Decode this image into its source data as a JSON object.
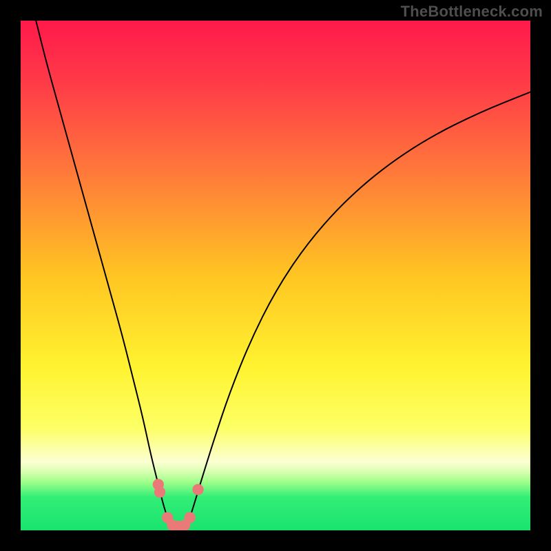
{
  "watermark": "TheBottleneck.com",
  "chart_data": {
    "type": "line",
    "title": "",
    "xlabel": "",
    "ylabel": "",
    "xlim": [
      0,
      100
    ],
    "ylim": [
      0,
      100
    ],
    "gradient_stops": [
      {
        "offset": 0.0,
        "color": "#ff1a4b"
      },
      {
        "offset": 0.12,
        "color": "#ff3a48"
      },
      {
        "offset": 0.3,
        "color": "#ff7a3a"
      },
      {
        "offset": 0.5,
        "color": "#ffc522"
      },
      {
        "offset": 0.68,
        "color": "#fff330"
      },
      {
        "offset": 0.8,
        "color": "#fdff66"
      },
      {
        "offset": 0.865,
        "color": "#fcffd2"
      },
      {
        "offset": 0.885,
        "color": "#d8ffb0"
      },
      {
        "offset": 0.905,
        "color": "#9fff8a"
      },
      {
        "offset": 0.935,
        "color": "#33ee77"
      },
      {
        "offset": 1.0,
        "color": "#19e36e"
      }
    ],
    "series": [
      {
        "name": "left-curve",
        "stroke": "#000000",
        "x": [
          3.0,
          5.0,
          7.5,
          10.0,
          12.5,
          15.0,
          17.5,
          20.0,
          22.0,
          24.0,
          25.5,
          27.0,
          28.0,
          28.8
        ],
        "y": [
          100.0,
          92.0,
          83.0,
          74.0,
          65.0,
          56.0,
          47.0,
          38.0,
          30.0,
          22.0,
          15.0,
          9.0,
          5.0,
          2.5
        ]
      },
      {
        "name": "right-curve",
        "stroke": "#000000",
        "x": [
          33.2,
          34.0,
          35.5,
          38.0,
          41.0,
          45.0,
          50.0,
          56.0,
          63.0,
          71.0,
          80.0,
          90.0,
          100.0
        ],
        "y": [
          2.5,
          5.0,
          10.0,
          18.0,
          27.0,
          37.0,
          47.0,
          56.0,
          64.0,
          71.0,
          77.0,
          82.0,
          86.0
        ]
      },
      {
        "name": "bottom-link",
        "stroke": "#e97a78",
        "x": [
          28.8,
          29.8,
          31.0,
          32.2,
          33.2
        ],
        "y": [
          2.5,
          1.0,
          0.8,
          1.0,
          2.5
        ]
      }
    ],
    "markers": [
      {
        "x": 27.0,
        "y": 9.0,
        "r": 1.1,
        "color": "#e97a78"
      },
      {
        "x": 27.3,
        "y": 7.5,
        "r": 1.1,
        "color": "#e97a78"
      },
      {
        "x": 28.8,
        "y": 2.5,
        "r": 1.1,
        "color": "#e97a78"
      },
      {
        "x": 29.8,
        "y": 1.0,
        "r": 1.1,
        "color": "#e97a78"
      },
      {
        "x": 31.0,
        "y": 0.8,
        "r": 1.1,
        "color": "#e97a78"
      },
      {
        "x": 32.2,
        "y": 1.0,
        "r": 1.1,
        "color": "#e97a78"
      },
      {
        "x": 33.2,
        "y": 2.5,
        "r": 1.1,
        "color": "#e97a78"
      },
      {
        "x": 34.8,
        "y": 8.0,
        "r": 1.1,
        "color": "#e97a78"
      }
    ]
  }
}
